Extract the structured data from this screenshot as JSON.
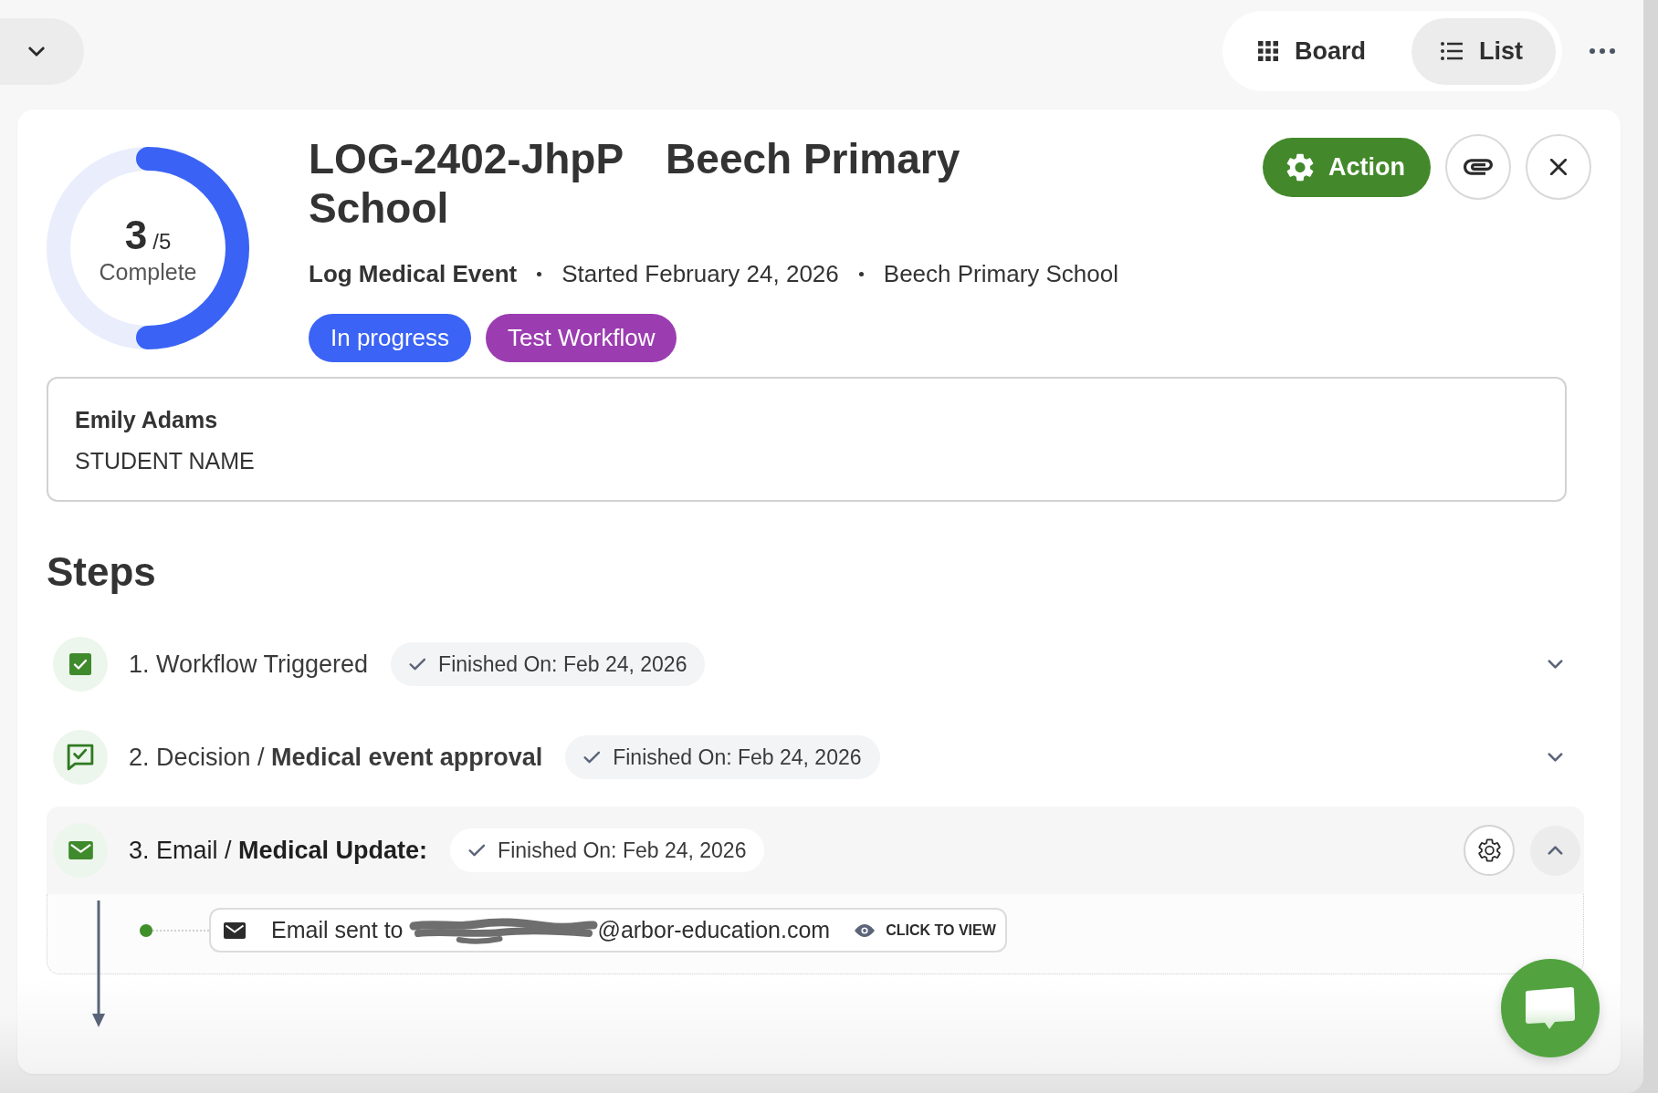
{
  "view_switch": [
    {
      "label": "Board",
      "selected": false
    },
    {
      "label": "List",
      "selected": true
    }
  ],
  "record": {
    "progress": {
      "count": "3",
      "total": "/5",
      "caption": "Complete",
      "level": 0.5
    },
    "code": "LOG-2402-JhpP",
    "title": "Beech Primary School",
    "meta": [
      "Log Medical Event",
      "Started February 24, 2026",
      "Beech Primary School"
    ],
    "tags": [
      {
        "label": "In progress",
        "color": "#3b63f5"
      },
      {
        "label": "Test Workflow",
        "color": "#9b3db1"
      }
    ],
    "action_button": "Action",
    "student": {
      "name": "Emily Adams",
      "label": "STUDENT NAME"
    }
  },
  "steps": {
    "heading": "Steps",
    "items": [
      {
        "kind": "trigger",
        "label": "1. Workflow Triggered",
        "status": "Finished On: Feb 24, 2026",
        "expanded": false
      },
      {
        "kind": "decision",
        "label": "2. Decision / **Medical event approval**",
        "status": "Finished On: Feb 24, 2026",
        "expanded": false
      },
      {
        "kind": "email",
        "label": "3. Email / **Medical Update:**",
        "status": "Finished On: Feb 24, 2026",
        "expanded": true,
        "log": [
          {
            "text": "Email sent to",
            "redacted": true,
            "recipient": "@arbor-education.com",
            "link": "CLICK TO VIEW"
          }
        ]
      }
    ]
  }
}
